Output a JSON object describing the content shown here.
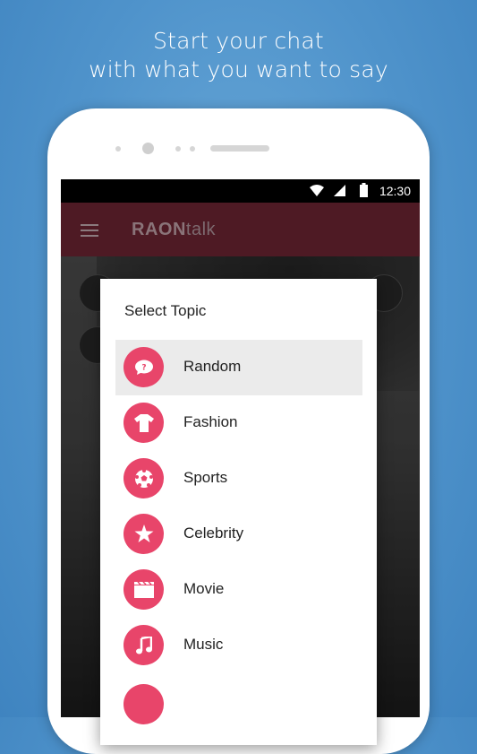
{
  "promo": {
    "line1": "Start your chat",
    "line2": "with what you want to say"
  },
  "statusbar": {
    "time": "12:30",
    "icons": [
      "wifi-icon",
      "signal-icon",
      "battery-icon"
    ]
  },
  "appbar": {
    "brand_bold": "RAON",
    "brand_light": "talk",
    "menu_icon": "hamburger-menu-icon"
  },
  "dialog": {
    "title": "Select Topic",
    "topics": [
      {
        "label": "Random",
        "icon": "speech-bubble-question-icon",
        "selected": true
      },
      {
        "label": "Fashion",
        "icon": "tshirt-icon",
        "selected": false
      },
      {
        "label": "Sports",
        "icon": "soccer-ball-icon",
        "selected": false
      },
      {
        "label": "Celebrity",
        "icon": "star-icon",
        "selected": false
      },
      {
        "label": "Movie",
        "icon": "clapperboard-icon",
        "selected": false
      },
      {
        "label": "Music",
        "icon": "music-note-icon",
        "selected": false
      }
    ]
  },
  "colors": {
    "topic_circle": "#e8456a",
    "appbar": "#4e1a24",
    "background": "#4f93cb"
  }
}
